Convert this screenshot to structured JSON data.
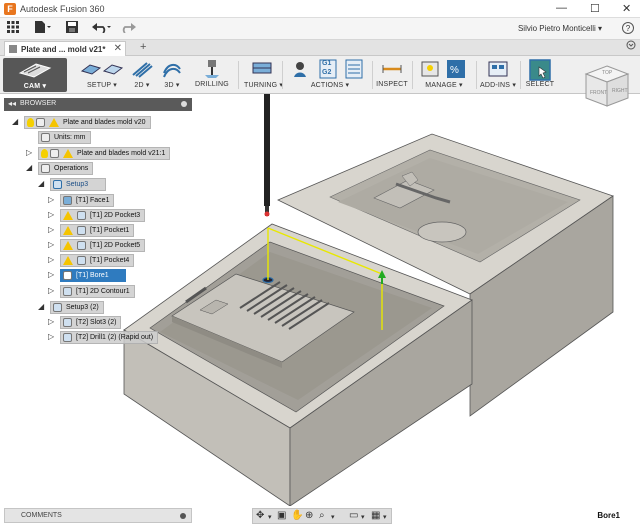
{
  "window": {
    "title": "Autodesk Fusion 360",
    "minimize": "—",
    "maximize": "☐",
    "close": "✕"
  },
  "quick_access": {
    "user": "Silvio Pietro Monticelli ▾",
    "help": "?"
  },
  "doc_tab": {
    "label": "Plate and ... mold v21*",
    "close": "✕",
    "add": "+"
  },
  "workspace": {
    "label": "CAM ▾"
  },
  "toolbar": [
    {
      "id": "setup",
      "label": "SETUP ▾",
      "icon": "setup-icon"
    },
    {
      "id": "2d",
      "label": "2D ▾",
      "icon": "2d-toolpath-icon"
    },
    {
      "id": "3d",
      "label": "3D ▾",
      "icon": "3d-toolpath-icon"
    },
    {
      "id": "drilling",
      "label": "DRILLING",
      "icon": "drill-icon"
    },
    {
      "id": "turning",
      "label": "TURNING ▾",
      "icon": "turning-icon"
    },
    {
      "id": "actions",
      "label": "ACTIONS ▾",
      "icon": "actions-icon"
    },
    {
      "id": "inspect",
      "label": "INSPECT",
      "icon": "inspect-icon"
    },
    {
      "id": "manage",
      "label": "MANAGE ▾",
      "icon": "manage-icon"
    },
    {
      "id": "addins",
      "label": "ADD-INS ▾",
      "icon": "addins-icon"
    },
    {
      "id": "select",
      "label": "SELECT",
      "icon": "select-icon"
    }
  ],
  "actions_icon_text": {
    "g1": "G1",
    "g2": "G2"
  },
  "browser": {
    "title": "BROWSER",
    "items": [
      {
        "label": "Plate and blades mold v20",
        "arrow": "◢"
      },
      {
        "label": "Units: mm",
        "arrow": ""
      },
      {
        "label": "Plate and blades mold v21:1",
        "arrow": "▷"
      },
      {
        "label": "Operations",
        "arrow": "◢"
      },
      {
        "label": "Setup3",
        "arrow": "◢"
      },
      {
        "label": "[T1] Face1",
        "arrow": "▷"
      },
      {
        "label": "[T1] 2D Pocket3",
        "arrow": "▷"
      },
      {
        "label": "[T1] Pocket1",
        "arrow": "▷"
      },
      {
        "label": "[T1] 2D Pocket5",
        "arrow": "▷"
      },
      {
        "label": "[T1] Pocket4",
        "arrow": "▷"
      },
      {
        "label": "[T1] Bore1",
        "arrow": "▷"
      },
      {
        "label": "[T1] 2D Contour1",
        "arrow": "▷"
      },
      {
        "label": "Setup3 (2)",
        "arrow": "◢"
      },
      {
        "label": "[T2] Slot3 (2)",
        "arrow": "▷"
      },
      {
        "label": "[T2] Drill1 (2) (Rapid out)",
        "arrow": "▷"
      }
    ]
  },
  "viewcube": {
    "top": "TOP",
    "front": "FRONT",
    "right": "RIGHT"
  },
  "comments": {
    "label": "COMMENTS"
  },
  "status": {
    "selection": "Bore1"
  },
  "colors": {
    "mold": "#c9c6be",
    "toolpath": "#e8e800",
    "selected": "#2f7bbf"
  }
}
